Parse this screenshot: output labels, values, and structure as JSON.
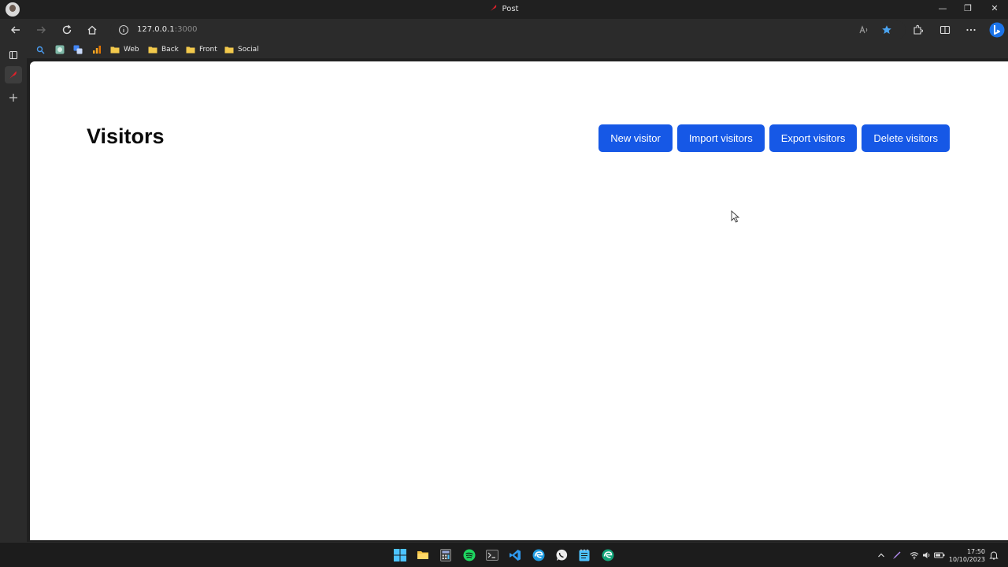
{
  "window": {
    "title": "Post",
    "controls": {
      "minimize": "—",
      "restore": "❐",
      "close": "✕"
    }
  },
  "browser": {
    "url_host": "127.0.0.1",
    "url_port": ":3000",
    "bookmarks": [
      {
        "label": "Web"
      },
      {
        "label": "Back"
      },
      {
        "label": "Front"
      },
      {
        "label": "Social"
      }
    ]
  },
  "page": {
    "title": "Visitors",
    "buttons": {
      "new": "New visitor",
      "import": "Import visitors",
      "export": "Export visitors",
      "delete": "Delete visitors"
    }
  },
  "taskbar": {
    "time": "17:50",
    "date": "10/10/2023"
  },
  "colors": {
    "accent": "#1658e6",
    "chrome": "#2b2b2b",
    "titlebar": "#202020"
  }
}
